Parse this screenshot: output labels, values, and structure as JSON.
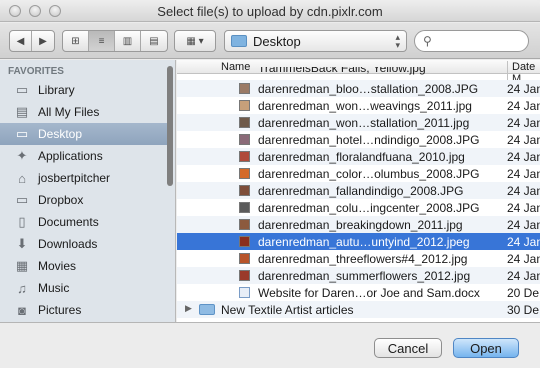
{
  "window": {
    "title": "Select file(s) to upload by cdn.pixlr.com"
  },
  "toolbar": {
    "back_icon": "chevron-left",
    "forward_icon": "chevron-right",
    "views": [
      "icon-view",
      "list-view",
      "column-view",
      "cover-flow-view"
    ],
    "active_view": "list-view",
    "arrange_icon": "grid-icon",
    "location": "Desktop",
    "search_placeholder": ""
  },
  "sidebar": {
    "heading": "FAVORITES",
    "items": [
      {
        "label": "Library",
        "icon": "folder-icon"
      },
      {
        "label": "All My Files",
        "icon": "files-icon"
      },
      {
        "label": "Desktop",
        "icon": "desktop-icon",
        "selected": true
      },
      {
        "label": "Applications",
        "icon": "applications-icon"
      },
      {
        "label": "josbertpitcher",
        "icon": "home-icon"
      },
      {
        "label": "Dropbox",
        "icon": "folder-icon"
      },
      {
        "label": "Documents",
        "icon": "documents-icon"
      },
      {
        "label": "Downloads",
        "icon": "downloads-icon"
      },
      {
        "label": "Movies",
        "icon": "movies-icon"
      },
      {
        "label": "Music",
        "icon": "music-icon"
      },
      {
        "label": "Pictures",
        "icon": "pictures-icon"
      }
    ]
  },
  "filelist": {
    "col_name": "Name",
    "col_date": "Date M",
    "rows": [
      {
        "name": "TrammelsBack Falls, Yellow.jpg",
        "date": "",
        "partial": true
      },
      {
        "name": "darenredman_bloo…stallation_2008.JPG",
        "date": "24 Jan",
        "thumb": "#9a7a66"
      },
      {
        "name": "darenredman_won…weavings_2011.jpg",
        "date": "24 Jan",
        "thumb": "#c7a07a"
      },
      {
        "name": "darenredman_won…stallation_2011.jpg",
        "date": "24 Jan",
        "thumb": "#6f5a4a"
      },
      {
        "name": "darenredman_hotel…ndindigo_2008.JPG",
        "date": "24 Jan",
        "thumb": "#8a6a78"
      },
      {
        "name": "darenredman_floralandfuana_2010.jpg",
        "date": "24 Jan",
        "thumb": "#b04a3a"
      },
      {
        "name": "darenredman_color…olumbus_2008.JPG",
        "date": "24 Jan",
        "thumb": "#d46a2a"
      },
      {
        "name": "darenredman_fallandindigo_2008.JPG",
        "date": "24 Jan",
        "thumb": "#7e4e3a"
      },
      {
        "name": "darenredman_colu…ingcenter_2008.JPG",
        "date": "24 Jan",
        "thumb": "#5a5a5a"
      },
      {
        "name": "darenredman_breakingdown_2011.jpg",
        "date": "24 Jan",
        "thumb": "#8c5a3e"
      },
      {
        "name": "darenredman_autu…untyind_2012.jpeg",
        "date": "24 Jan",
        "thumb": "#8a2e1e",
        "selected": true
      },
      {
        "name": "darenredman_threeflowers#4_2012.jpg",
        "date": "24 Jan",
        "thumb": "#b8542a"
      },
      {
        "name": "darenredman_summerflowers_2012.jpg",
        "date": "24 Jan",
        "thumb": "#9a3a2a"
      },
      {
        "name": "Website for Daren…or Joe and Sam.docx",
        "date": "20 De",
        "thumb": "#e8eef7"
      },
      {
        "name": "New Textile Artist articles",
        "date": "30 De",
        "folder": true
      }
    ]
  },
  "footer": {
    "cancel": "Cancel",
    "open": "Open"
  }
}
